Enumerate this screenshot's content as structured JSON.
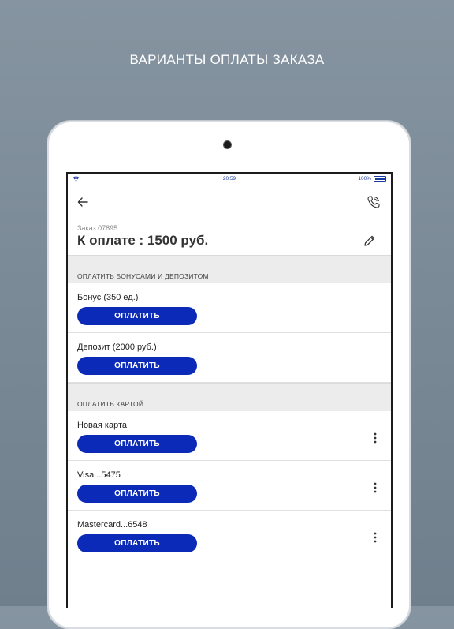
{
  "headline": "ВАРИАНТЫ ОПЛАТЫ ЗАКАЗА",
  "status_bar": {
    "time": "20:59",
    "battery": "100%"
  },
  "order": {
    "number_label": "Заказ 07895",
    "amount_label": "К оплате : 1500 руб."
  },
  "sections": [
    {
      "title": "ОПЛАТИТЬ БОНУСАМИ И ДЕПОЗИТОМ"
    },
    {
      "title": "ОПЛАТИТЬ КАРТОЙ"
    }
  ],
  "bonus_items": [
    {
      "label": "Бонус (350 ед.)",
      "button": "ОПЛАТИТЬ"
    },
    {
      "label": "Депозит (2000 руб.)",
      "button": "ОПЛАТИТЬ"
    }
  ],
  "card_items": [
    {
      "label": "Новая карта",
      "button": "ОПЛАТИТЬ"
    },
    {
      "label": "Visa...5475",
      "button": "ОПЛАТИТЬ"
    },
    {
      "label": "Mastercard...6548",
      "button": "ОПЛАТИТЬ"
    }
  ],
  "icons": {
    "back": "arrow-left-icon",
    "call": "phone-icon",
    "edit": "pencil-icon",
    "more": "more-vertical-icon",
    "wifi": "wifi-icon",
    "battery": "battery-icon"
  },
  "colors": {
    "accent": "#0c2ab8",
    "status_text": "#1b3a9e",
    "section_bg": "#ececec",
    "background": "#7a8a96"
  }
}
